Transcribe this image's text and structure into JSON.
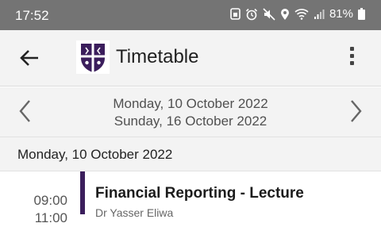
{
  "status_bar": {
    "time": "17:52",
    "battery": "81%",
    "icons": [
      "sim-icon",
      "alarm-icon",
      "mute-icon",
      "location-icon",
      "wifi-icon",
      "signal-icon",
      "battery-icon"
    ]
  },
  "app_bar": {
    "title": "Timetable",
    "logo": "university-crest-logo",
    "brand_color": "#3b1e5c"
  },
  "week_nav": {
    "start": "Monday, 10 October 2022",
    "end": "Sunday, 16 October 2022"
  },
  "days": [
    {
      "heading": "Monday, 10 October 2022",
      "events": [
        {
          "start": "09:00",
          "end": "11:00",
          "title": "Financial Reporting - Lecture",
          "lecturer": "Dr Yasser Eliwa"
        }
      ]
    }
  ]
}
